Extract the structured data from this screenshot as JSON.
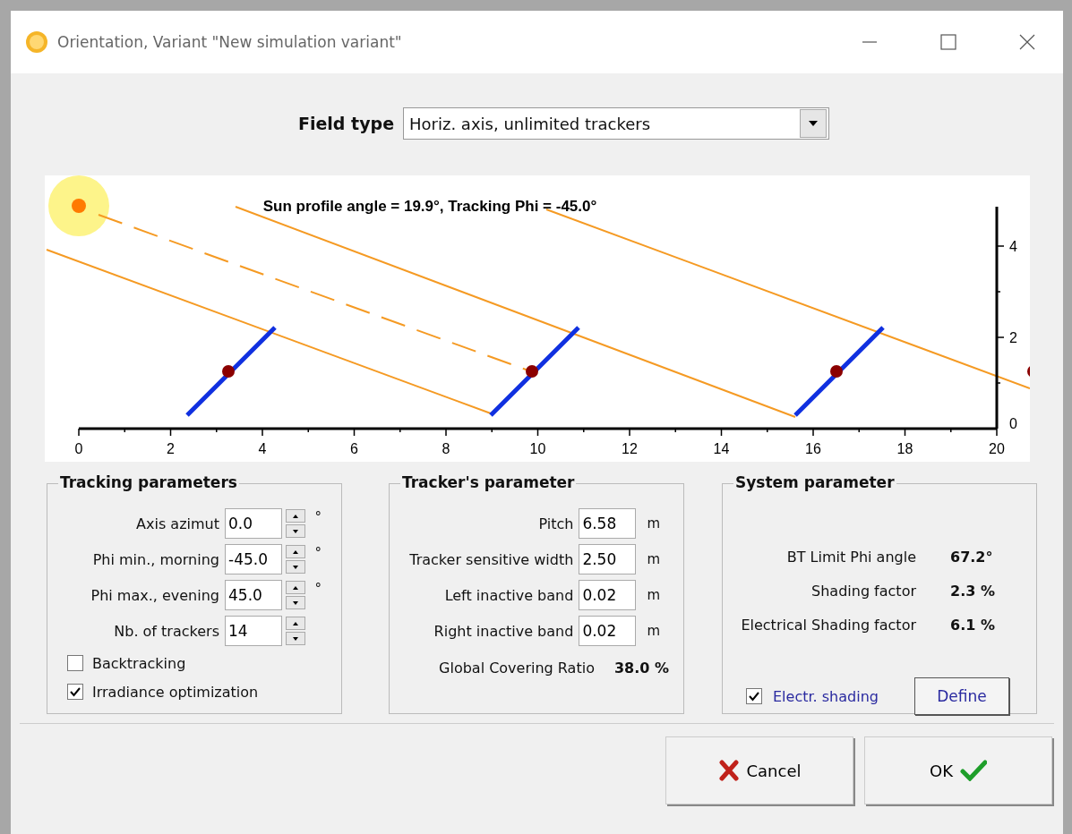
{
  "window": {
    "title": "Orientation, Variant \"New simulation variant\""
  },
  "field_type": {
    "label": "Field type",
    "value": "Horiz. axis, unlimited trackers"
  },
  "diagram": {
    "title": "Sun profile angle = 19.9°, Tracking Phi = -45.0°",
    "x_tick_labels": [
      "0",
      "2",
      "4",
      "6",
      "8",
      "10",
      "12",
      "14",
      "16",
      "18",
      "20"
    ],
    "y_tick_labels": [
      "4",
      "2",
      "0"
    ]
  },
  "tracking_parameters": {
    "title": "Tracking parameters",
    "fields": [
      {
        "label": "Axis azimut",
        "value": "0.0",
        "unit": "°"
      },
      {
        "label": "Phi min., morning",
        "value": "-45.0",
        "unit": "°"
      },
      {
        "label": "Phi max., evening",
        "value": "45.0",
        "unit": "°"
      },
      {
        "label": "Nb. of trackers",
        "value": "14"
      }
    ],
    "checkboxes": [
      {
        "label": "Backtracking",
        "checked": false
      },
      {
        "label": "Irradiance optimization",
        "checked": true
      }
    ]
  },
  "trackers_parameter": {
    "title": "Tracker's parameter",
    "fields": [
      {
        "label": "Pitch",
        "value": "6.58",
        "unit": "m"
      },
      {
        "label": "Tracker sensitive width",
        "value": "2.50",
        "unit": "m"
      },
      {
        "label": "Left inactive band",
        "value": "0.02",
        "unit": "m"
      },
      {
        "label": "Right inactive band",
        "value": "0.02",
        "unit": "m"
      }
    ],
    "result": {
      "label": "Global Covering Ratio",
      "value": "38.0 %"
    }
  },
  "system_parameter": {
    "title": "System parameter",
    "results": [
      {
        "label": "BT Limit Phi angle",
        "value": "67.2°"
      },
      {
        "label": "Shading factor",
        "value": "2.3 %"
      },
      {
        "label": "Electrical Shading factor",
        "value": "6.1 %"
      }
    ],
    "checkbox": {
      "label": "Electr. shading",
      "checked": true
    },
    "define_button": "Define"
  },
  "buttons": {
    "cancel": "Cancel",
    "ok": "OK"
  }
}
